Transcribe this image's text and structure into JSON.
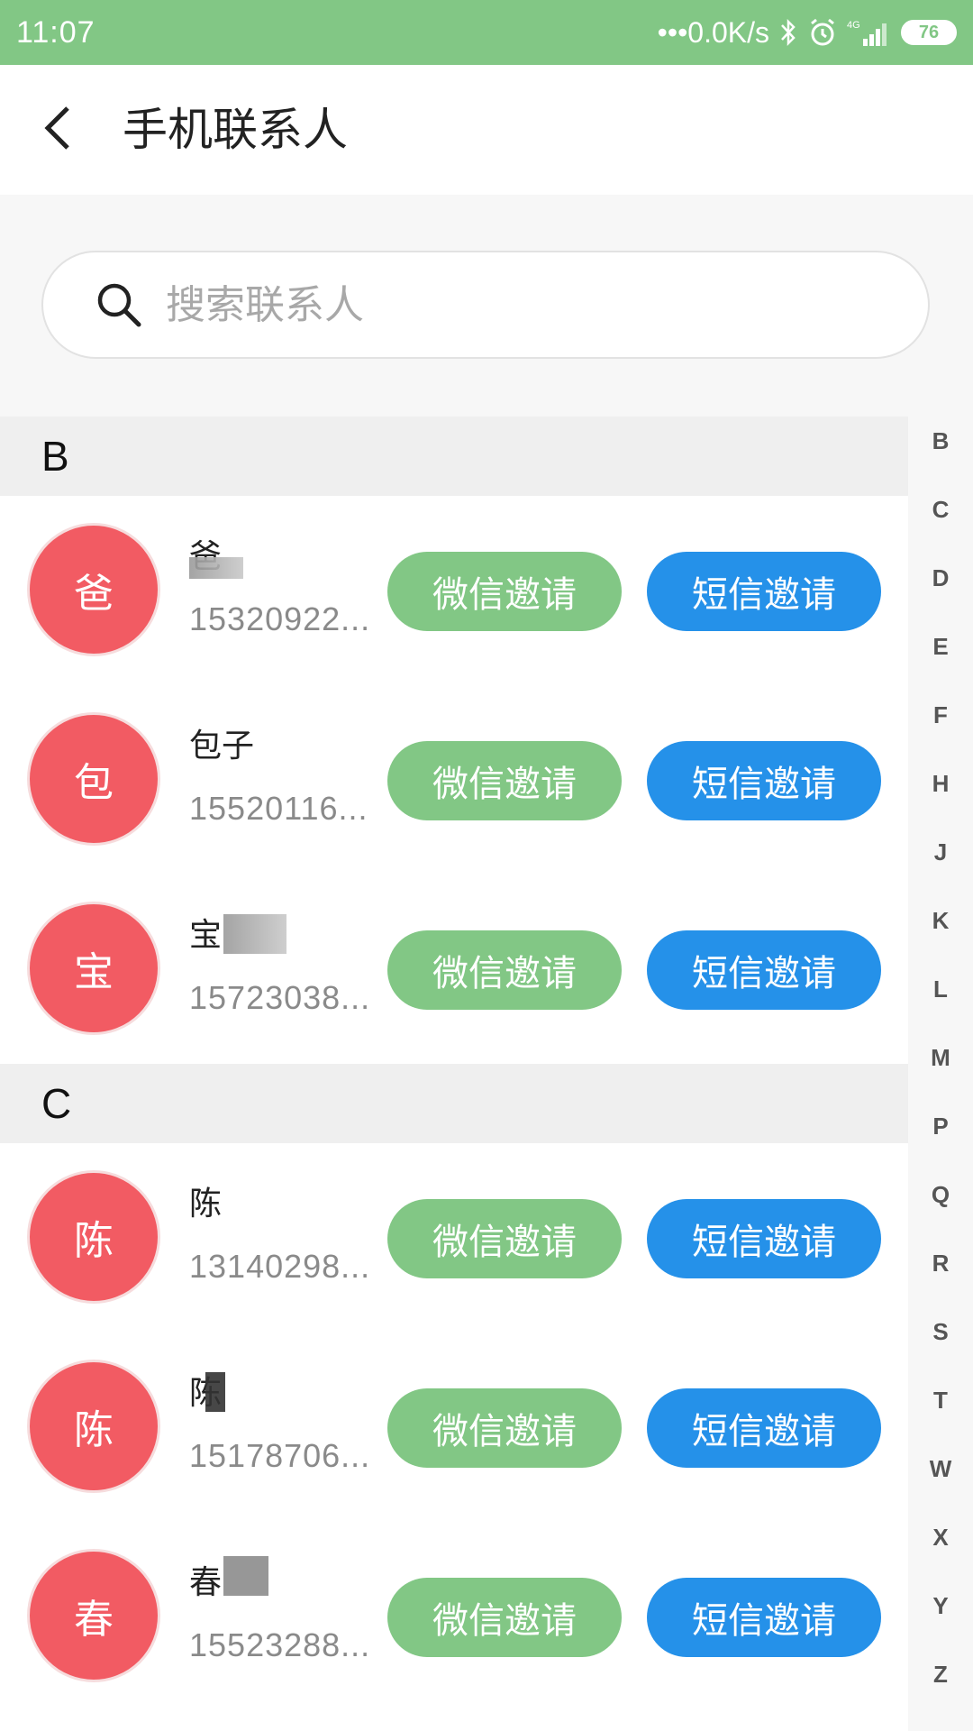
{
  "status_bar": {
    "time": "11:07",
    "network_speed": "•••0.0K/s",
    "network_type": "4G",
    "battery": "76",
    "icons": [
      "bluetooth-icon",
      "alarm-icon",
      "signal-icon",
      "battery-icon"
    ]
  },
  "header": {
    "title": "手机联系人",
    "back_icon": "chevron-left-icon"
  },
  "search": {
    "placeholder": "搜索联系人",
    "value": "",
    "icon": "search-icon"
  },
  "buttons": {
    "wechat_invite": "微信邀请",
    "sms_invite": "短信邀请"
  },
  "sections": [
    {
      "letter": "B",
      "contacts": [
        {
          "avatar": "爸",
          "name": "爸",
          "phone": "15320922..."
        },
        {
          "avatar": "包",
          "name": "包子",
          "phone": "15520116..."
        },
        {
          "avatar": "宝",
          "name": "宝",
          "phone": "15723038..."
        }
      ]
    },
    {
      "letter": "C",
      "contacts": [
        {
          "avatar": "陈",
          "name": "陈",
          "phone": "13140298..."
        },
        {
          "avatar": "陈",
          "name": "陈",
          "phone": "15178706..."
        },
        {
          "avatar": "春",
          "name": "春",
          "phone": "15523288..."
        }
      ]
    }
  ],
  "index_bar": [
    "B",
    "C",
    "D",
    "E",
    "F",
    "H",
    "J",
    "K",
    "L",
    "M",
    "P",
    "Q",
    "R",
    "S",
    "T",
    "W",
    "X",
    "Y",
    "Z"
  ],
  "colors": {
    "status_bar": "#82c785",
    "wechat_button": "#82c785",
    "sms_button": "#2591e9",
    "avatar": "#f25b63",
    "section_header": "#efefef"
  }
}
